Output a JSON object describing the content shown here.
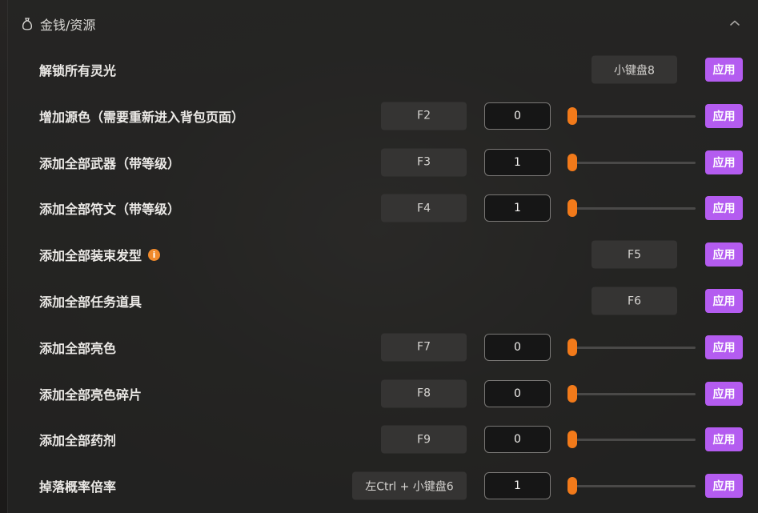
{
  "section": {
    "title": "金钱/资源",
    "icon": "money-bag-icon",
    "collapse_icon": "chevron-up-icon"
  },
  "colors": {
    "accent": "#f27a1a",
    "apply_button": "#b45cf0",
    "info_badge": "#f08a2c"
  },
  "apply_label": "应用",
  "rows": [
    {
      "label": "解锁所有灵光",
      "hotkey": "小键盘8",
      "hotkey_pos": "right"
    },
    {
      "label": "增加源色（需要重新进入背包页面）",
      "hotkey": "F2",
      "hotkey_pos": "mid",
      "value": "0",
      "slider_level": 0
    },
    {
      "label": "添加全部武器（带等级）",
      "hotkey": "F3",
      "hotkey_pos": "mid",
      "value": "1",
      "slider_level": 0
    },
    {
      "label": "添加全部符文（带等级）",
      "hotkey": "F4",
      "hotkey_pos": "mid",
      "value": "1",
      "slider_level": 0
    },
    {
      "label": "添加全部装束发型",
      "info": "i",
      "hotkey": "F5",
      "hotkey_pos": "right"
    },
    {
      "label": "添加全部任务道具",
      "hotkey": "F6",
      "hotkey_pos": "right"
    },
    {
      "label": "添加全部亮色",
      "hotkey": "F7",
      "hotkey_pos": "mid",
      "value": "0",
      "slider_level": 0
    },
    {
      "label": "添加全部亮色碎片",
      "hotkey": "F8",
      "hotkey_pos": "mid",
      "value": "0",
      "slider_level": 0
    },
    {
      "label": "添加全部药剂",
      "hotkey": "F9",
      "hotkey_pos": "mid",
      "value": "0",
      "slider_level": 0
    },
    {
      "label": "掉落概率倍率",
      "hotkey": "左Ctrl + 小键盘6",
      "hotkey_pos": "wide",
      "value": "1",
      "slider_level": 0
    }
  ]
}
